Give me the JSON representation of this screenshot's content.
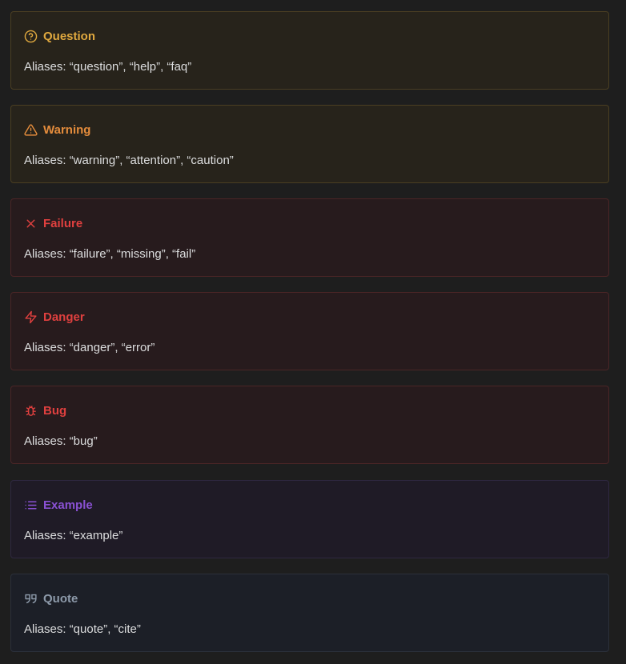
{
  "callouts": [
    {
      "title": "Question",
      "body": "Aliases: “question”, “help”, “faq”",
      "icon": "question-circle-icon",
      "color": "#e0a93f"
    },
    {
      "title": "Warning",
      "body": "Aliases: “warning”, “attention”, “caution”",
      "icon": "warning-triangle-icon",
      "color": "#e48c3c"
    },
    {
      "title": "Failure",
      "body": "Aliases: “failure”, “missing”, “fail”",
      "icon": "x-icon",
      "color": "#e0403f"
    },
    {
      "title": "Danger",
      "body": "Aliases: “danger”, “error”",
      "icon": "zap-icon",
      "color": "#e0403f"
    },
    {
      "title": "Bug",
      "body": "Aliases: “bug”",
      "icon": "bug-icon",
      "color": "#e0403f"
    },
    {
      "title": "Example",
      "body": "Aliases: “example”",
      "icon": "list-icon",
      "color": "#8a51d4"
    },
    {
      "title": "Quote",
      "body": "Aliases: “quote”, “cite”",
      "icon": "quote-icon",
      "color": "#8d9aaa"
    }
  ]
}
